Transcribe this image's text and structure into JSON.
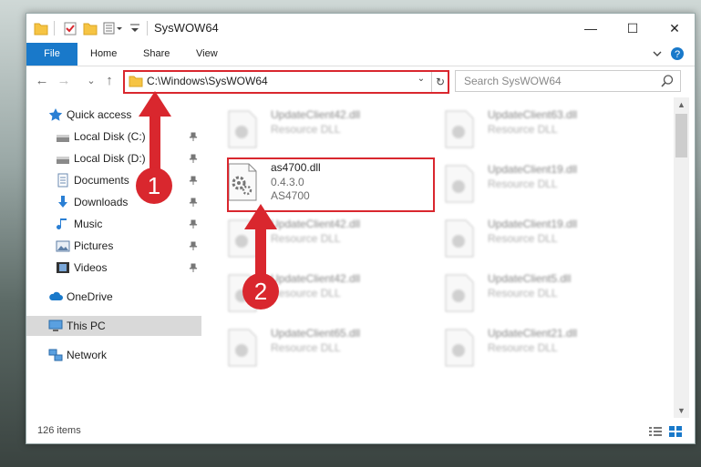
{
  "window": {
    "title": "SysWOW64"
  },
  "titlebar": {
    "minimize": "—",
    "maximize": "☐",
    "close": "✕"
  },
  "ribbon": {
    "tabs": [
      {
        "label": "File",
        "active": true
      },
      {
        "label": "Home"
      },
      {
        "label": "Share"
      },
      {
        "label": "View"
      }
    ]
  },
  "nav": {
    "back": "←",
    "forward": "→",
    "recent": "⌄",
    "up": "↑"
  },
  "address": {
    "path": "C:\\Windows\\SysWOW64",
    "dropdown": "⌄",
    "refresh": "↻"
  },
  "search": {
    "placeholder": "Search SysWOW64"
  },
  "sidebar": {
    "items": [
      {
        "label": "Quick access",
        "icon": "star-icon",
        "pinned": false
      },
      {
        "label": "Local Disk (C:)",
        "icon": "drive-icon",
        "pinned": true
      },
      {
        "label": "Local Disk (D:)",
        "icon": "drive-icon",
        "pinned": true
      },
      {
        "label": "Documents",
        "icon": "documents-icon",
        "pinned": true
      },
      {
        "label": "Downloads",
        "icon": "download-icon",
        "pinned": true
      },
      {
        "label": "Music",
        "icon": "music-icon",
        "pinned": true
      },
      {
        "label": "Pictures",
        "icon": "pictures-icon",
        "pinned": true
      },
      {
        "label": "Videos",
        "icon": "videos-icon",
        "pinned": true
      },
      {
        "label": "OneDrive",
        "icon": "cloud-icon",
        "pinned": false
      },
      {
        "label": "This PC",
        "icon": "computer-icon",
        "pinned": false,
        "selected": true
      },
      {
        "label": "Network",
        "icon": "network-icon",
        "pinned": false
      }
    ]
  },
  "files": [
    {
      "name": "UpdateClient42.dll",
      "sub1": "Resource DLL",
      "sub2": ""
    },
    {
      "name": "UpdateClient63.dll",
      "sub1": "Resource DLL",
      "sub2": ""
    },
    {
      "name": "as4700.dll",
      "sub1": "0.4.3.0",
      "sub2": "AS4700",
      "highlight": true
    },
    {
      "name": "UpdateClient19.dll",
      "sub1": "Resource DLL",
      "sub2": ""
    },
    {
      "name": "UpdateClient42.dll",
      "sub1": "Resource DLL",
      "sub2": ""
    },
    {
      "name": "UpdateClient19.dll",
      "sub1": "Resource DLL",
      "sub2": ""
    },
    {
      "name": "UpdateClient42.dll",
      "sub1": "Resource DLL",
      "sub2": ""
    },
    {
      "name": "UpdateClient5.dll",
      "sub1": "Resource DLL",
      "sub2": ""
    },
    {
      "name": "UpdateClient65.dll",
      "sub1": "Resource DLL",
      "sub2": ""
    },
    {
      "name": "UpdateClient21.dll",
      "sub1": "Resource DLL",
      "sub2": ""
    }
  ],
  "status": {
    "count": "126 items"
  },
  "annotations": {
    "step1": "1",
    "step2": "2",
    "color": "#d9272e"
  },
  "colors": {
    "accent": "#1979ca",
    "highlight": "#d9272e"
  }
}
